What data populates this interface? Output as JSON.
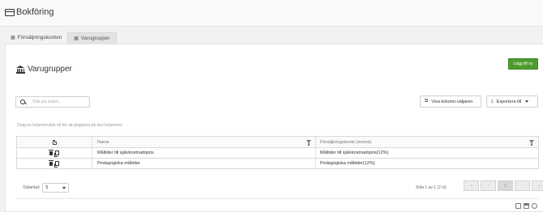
{
  "app": {
    "title": "Bokföring"
  },
  "tabs": [
    {
      "label": "Försäljningskonton",
      "icon": "category-icon",
      "state": "active"
    },
    {
      "label": "Varugrupper",
      "icon": "category-icon",
      "state": "inactive"
    }
  ],
  "section": {
    "title": "Varugrupper",
    "icon": "bank-icon"
  },
  "toolbar": {
    "new_label": "Lägg till ny",
    "search_placeholder": "Sök på sidan...",
    "columns_label": "Visa kolumn-väljaren",
    "export_label": "Exportera till"
  },
  "grid": {
    "group_hint": "Drag en kolumnrubrik hit för att gruppera på den kolumnen",
    "columns": [
      "",
      "Name",
      "Försäljningskonto (moms)"
    ],
    "rows": [
      {
        "name": "Måltider till självkostnadspris",
        "account": "Måltider till självkostnadspris(12%)"
      },
      {
        "name": "Pedagogiska måltider",
        "account": "Pedagogiska måltider(12%)"
      }
    ]
  },
  "pager": {
    "size_label": "Sidantal:",
    "size_value": "5",
    "info": "Sida 1 av 1 (2 st)",
    "first": "«",
    "prev": "‹",
    "current": "1",
    "next": "›",
    "last": "»"
  },
  "colors": {
    "accent": "#4f9a2e"
  }
}
